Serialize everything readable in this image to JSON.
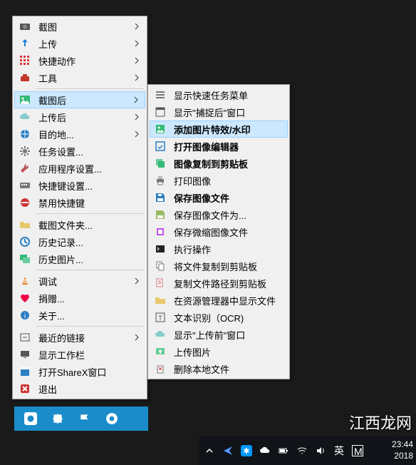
{
  "main_menu": {
    "items": [
      {
        "label": "截图",
        "arrow": true
      },
      {
        "label": "上传",
        "arrow": true
      },
      {
        "label": "快捷动作",
        "arrow": true
      },
      {
        "label": "工具",
        "arrow": true
      }
    ],
    "items2": [
      {
        "label": "截图后",
        "arrow": true,
        "hl": true
      },
      {
        "label": "上传后",
        "arrow": true
      },
      {
        "label": "目的地...",
        "arrow": true
      },
      {
        "label": "任务设置..."
      },
      {
        "label": "应用程序设置..."
      },
      {
        "label": "快捷键设置..."
      },
      {
        "label": "禁用快捷键"
      }
    ],
    "items3": [
      {
        "label": "截图文件夹..."
      },
      {
        "label": "历史记录..."
      },
      {
        "label": "历史图片..."
      }
    ],
    "items4": [
      {
        "label": "调试",
        "arrow": true
      },
      {
        "label": "捐赠..."
      },
      {
        "label": "关于..."
      }
    ],
    "items5": [
      {
        "label": "最近的链接",
        "arrow": true
      },
      {
        "label": "显示工作栏"
      },
      {
        "label": "打开ShareX窗口"
      },
      {
        "label": "退出"
      }
    ]
  },
  "sub_menu": {
    "items": [
      {
        "label": "显示快速任务菜单"
      },
      {
        "label": "显示\"捕捉后\"窗口"
      },
      {
        "label": "添加图片特效/水印",
        "hl": true,
        "bold": true
      },
      {
        "label": "打开图像编辑器",
        "bold": true
      },
      {
        "label": "图像复制到剪贴板",
        "bold": true
      },
      {
        "label": "打印图像"
      },
      {
        "label": "保存图像文件",
        "bold": true
      },
      {
        "label": "保存图像文件为..."
      },
      {
        "label": "保存微缩图像文件"
      },
      {
        "label": "执行操作"
      },
      {
        "label": "将文件复制到剪贴板"
      },
      {
        "label": "复制文件路径到剪贴板"
      },
      {
        "label": "在资源管理器中显示文件"
      },
      {
        "label": "文本识别（OCR)"
      },
      {
        "label": "显示\"上传前\"窗口"
      },
      {
        "label": "上传图片"
      },
      {
        "label": "删除本地文件"
      }
    ]
  },
  "taskbar": {
    "ime": "英",
    "ime2": "M",
    "time": "23:44",
    "date": "2018"
  },
  "watermark": "江西龙网"
}
